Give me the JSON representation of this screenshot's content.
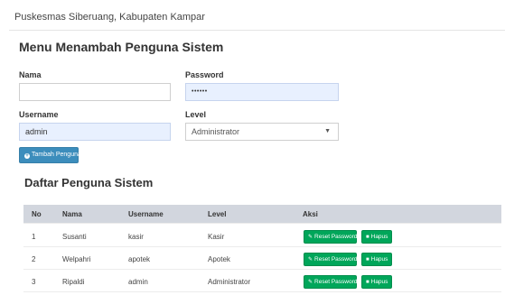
{
  "header": {
    "title": "Puskesmas Siberuang, Kabupaten Kampar"
  },
  "form": {
    "title": "Menu Menambah Penguna Sistem",
    "nama_label": "Nama",
    "nama_value": "",
    "password_label": "Password",
    "password_value": "••••••",
    "username_label": "Username",
    "username_value": "admin",
    "level_label": "Level",
    "level_value": "Administrator",
    "add_button": "Tambah Penguna"
  },
  "list": {
    "title": "Daftar Penguna Sistem",
    "columns": [
      "No",
      "Nama",
      "Username",
      "Level",
      "Aksi"
    ],
    "rows": [
      {
        "no": "1",
        "nama": "Susanti",
        "username": "kasir",
        "level": "Kasir"
      },
      {
        "no": "2",
        "nama": "Welpahri",
        "username": "apotek",
        "level": "Apotek"
      },
      {
        "no": "3",
        "nama": "Ripaldi",
        "username": "admin",
        "level": "Administrator"
      }
    ],
    "reset_label": "Reset Password",
    "hapus_label": "Hapus"
  },
  "colors": {
    "primary": "#3c8dbc",
    "success": "#00a65a",
    "table_header": "#d2d6de",
    "autofill": "#e8f0fe"
  },
  "icons": {
    "add": "plus-circle-icon",
    "reset": "edit-icon",
    "hapus": "trash-icon",
    "select": "chevron-down-icon"
  }
}
